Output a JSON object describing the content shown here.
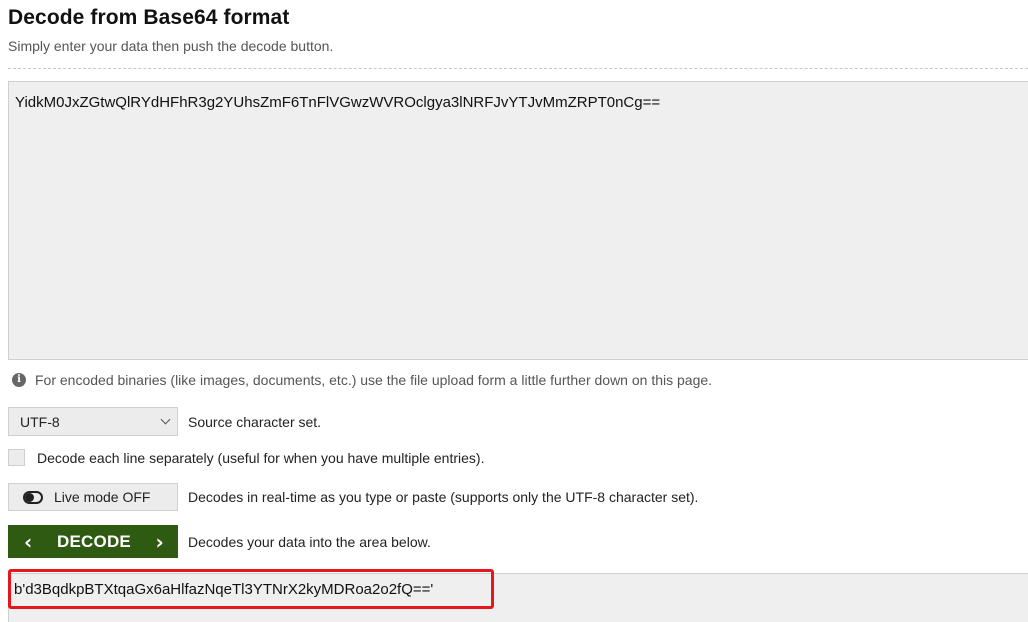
{
  "header": {
    "title": "Decode from Base64 format",
    "subtitle": "Simply enter your data then push the decode button."
  },
  "input": {
    "value": "YidkM0JxZGtwQlRYdHFhR3g2YUhsZmF6TnFlVGwzWVROclgya3lNRFJvYTJvMmZRPT0nCg=="
  },
  "info": {
    "icon": "info-icon",
    "text": "For encoded binaries (like images, documents, etc.) use the file upload form a little further down on this page."
  },
  "charset": {
    "selected": "UTF-8",
    "label": "Source character set."
  },
  "line_option": {
    "label": "Decode each line separately (useful for when you have multiple entries)."
  },
  "live_mode": {
    "button_label": "Live mode OFF",
    "description": "Decodes in real-time as you type or paste (supports only the UTF-8 character set)."
  },
  "decode": {
    "button_label": "DECODE",
    "description": "Decodes your data into the area below.",
    "color": "#2e5a12"
  },
  "output": {
    "value": "b'd3BqdkpBTXtqaGx6aHlfazNqeTl3YTNrX2kyMDRoa2o2fQ=='",
    "highlight_color": "#e5161c"
  }
}
